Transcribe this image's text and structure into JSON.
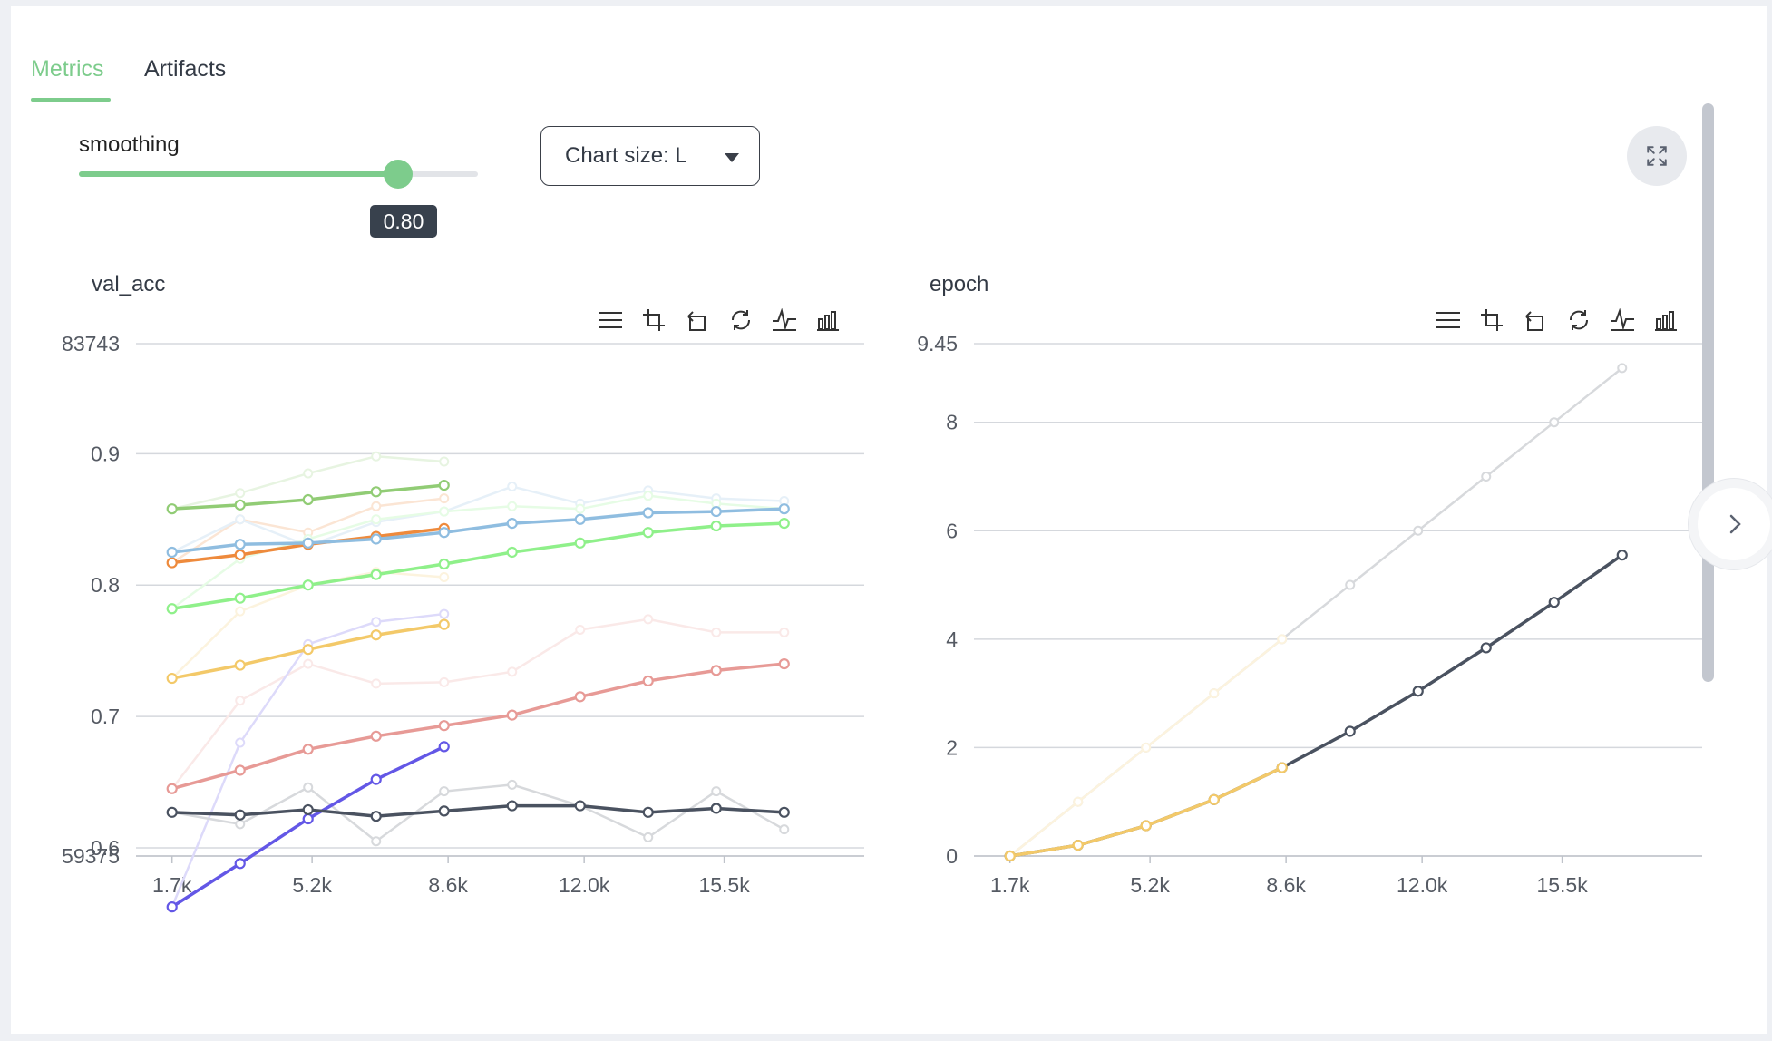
{
  "tabs": [
    {
      "label": "Metrics",
      "active": true
    },
    {
      "label": "Artifacts",
      "active": false
    }
  ],
  "smoothing": {
    "label": "smoothing",
    "value": 0.8,
    "value_label": "0.80"
  },
  "chart_size_select": {
    "label": "Chart size: L"
  },
  "colors": {
    "accent": "#7dcc8c",
    "text": "#333a45",
    "grid": "#d5d8dd"
  },
  "icons": {
    "expand": "expand-icon",
    "next": "chevron-right-icon",
    "toolbar": [
      "menu-icon",
      "zoom-icon",
      "zoom-reset-icon",
      "restore-icon",
      "line-chart-icon",
      "bar-chart-icon"
    ]
  },
  "chart_data": [
    {
      "type": "line",
      "title": "val_acc",
      "ylim": [
        0.59375,
        0.983743
      ],
      "yticks": [
        0.6,
        0.7,
        0.8,
        0.9
      ],
      "ytick_labels": [
        "0.6",
        "0.7",
        "0.8",
        "0.9"
      ],
      "ylim_labels": [
        "59375",
        "83743"
      ],
      "xticks": [
        1700,
        5200,
        8600,
        12000,
        15500
      ],
      "xtick_labels": [
        "1.7k",
        "5.2k",
        "8.6k",
        "12.0k",
        "15.5k"
      ],
      "xlim": [
        800,
        19000
      ],
      "grid": true,
      "series": [
        {
          "color": "#91cc75",
          "x": [
            1700,
            3400,
            5100,
            6800,
            8500
          ],
          "y": [
            0.858,
            0.861,
            0.865,
            0.871,
            0.876
          ],
          "raw": [
            0.858,
            0.87,
            0.885,
            0.898,
            0.894
          ]
        },
        {
          "color": "#ee8a3c",
          "x": [
            1700,
            3400,
            5100,
            6800,
            8500
          ],
          "y": [
            0.817,
            0.823,
            0.831,
            0.837,
            0.843
          ],
          "raw": [
            0.817,
            0.85,
            0.84,
            0.86,
            0.866
          ]
        },
        {
          "color": "#8fbde0",
          "x": [
            1700,
            3400,
            5100,
            6800,
            8500,
            10200,
            11900,
            13600,
            15300,
            17000
          ],
          "y": [
            0.825,
            0.831,
            0.832,
            0.835,
            0.84,
            0.847,
            0.85,
            0.855,
            0.856,
            0.858
          ],
          "raw": [
            0.825,
            0.85,
            0.83,
            0.848,
            0.856,
            0.875,
            0.862,
            0.872,
            0.866,
            0.864
          ]
        },
        {
          "color": "#8ff08a",
          "x": [
            1700,
            3400,
            5100,
            6800,
            8500,
            10200,
            11900,
            13600,
            15300,
            17000
          ],
          "y": [
            0.782,
            0.79,
            0.8,
            0.808,
            0.816,
            0.825,
            0.832,
            0.84,
            0.845,
            0.847
          ],
          "raw": [
            0.782,
            0.82,
            0.835,
            0.85,
            0.856,
            0.86,
            0.858,
            0.868,
            0.862,
            0.858
          ]
        },
        {
          "color": "#f3c969",
          "x": [
            1700,
            3400,
            5100,
            6800,
            8500
          ],
          "y": [
            0.729,
            0.739,
            0.751,
            0.762,
            0.77
          ],
          "raw": [
            0.729,
            0.78,
            0.8,
            0.81,
            0.806
          ]
        },
        {
          "color": "#e79a96",
          "x": [
            1700,
            3400,
            5100,
            6800,
            8500,
            10200,
            11900,
            13600,
            15300,
            17000
          ],
          "y": [
            0.645,
            0.659,
            0.675,
            0.685,
            0.693,
            0.701,
            0.715,
            0.727,
            0.735,
            0.74
          ],
          "raw": [
            0.645,
            0.712,
            0.74,
            0.725,
            0.726,
            0.734,
            0.766,
            0.774,
            0.764,
            0.764
          ]
        },
        {
          "color": "#6357e6",
          "x": [
            1700,
            3400,
            5100,
            6800,
            8500
          ],
          "y": [
            0.555,
            0.588,
            0.622,
            0.652,
            0.677
          ],
          "raw": [
            0.555,
            0.68,
            0.755,
            0.772,
            0.778
          ]
        },
        {
          "color": "#4a5260",
          "x": [
            1700,
            3400,
            5100,
            6800,
            8500,
            10200,
            11900,
            13600,
            15300,
            17000
          ],
          "y": [
            0.627,
            0.625,
            0.629,
            0.624,
            0.628,
            0.632,
            0.632,
            0.627,
            0.63,
            0.627
          ],
          "raw": [
            0.627,
            0.618,
            0.646,
            0.605,
            0.643,
            0.648,
            0.632,
            0.608,
            0.643,
            0.614
          ]
        }
      ]
    },
    {
      "type": "line",
      "title": "epoch",
      "ylim": [
        0,
        9.45
      ],
      "yticks": [
        0,
        2,
        4,
        6,
        8,
        9.45
      ],
      "ytick_labels": [
        "0",
        "2",
        "4",
        "6",
        "8",
        "9.45"
      ],
      "xticks": [
        1700,
        5200,
        8600,
        12000,
        15500
      ],
      "xtick_labels": [
        "1.7k",
        "5.2k",
        "8.6k",
        "12.0k",
        "15.5k"
      ],
      "xlim": [
        800,
        19000
      ],
      "grid": true,
      "series": [
        {
          "color": "#4a5260",
          "x": [
            1700,
            3400,
            5100,
            6800,
            8500,
            10200,
            11900,
            13600,
            15300,
            17000
          ],
          "y": [
            0,
            0.2,
            0.56,
            1.04,
            1.63,
            2.3,
            3.04,
            3.84,
            4.68,
            5.55
          ],
          "raw": [
            0,
            1,
            2,
            3,
            4,
            5,
            6,
            7,
            8,
            9
          ]
        },
        {
          "color": "#f3c969",
          "x": [
            1700,
            3400,
            5100,
            6800,
            8500
          ],
          "y": [
            0,
            0.2,
            0.56,
            1.04,
            1.63
          ],
          "raw": [
            0,
            1,
            2,
            3,
            4
          ]
        }
      ]
    }
  ]
}
